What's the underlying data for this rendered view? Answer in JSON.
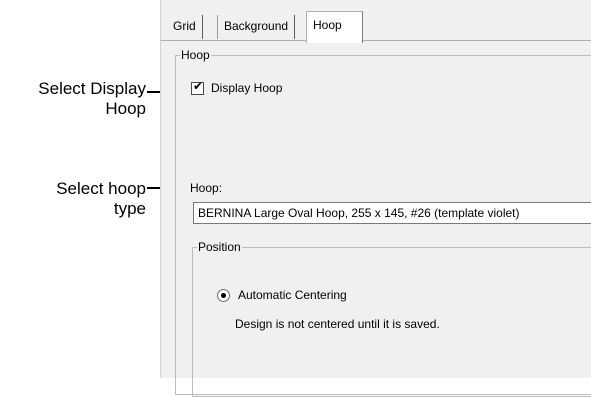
{
  "tabs": [
    {
      "label": "Grid"
    },
    {
      "label": "Background"
    },
    {
      "label": "Hoop"
    }
  ],
  "active_tab": "Hoop",
  "hoop_group": {
    "legend": "Hoop",
    "display_hoop": {
      "label": "Display Hoop",
      "checked": true
    },
    "hoop_field": {
      "label": "Hoop:",
      "value": "BERNINA Large Oval Hoop, 255 x 145, #26 (template violet)"
    }
  },
  "position_group": {
    "legend": "Position",
    "automatic_centering": {
      "label": "Automatic Centering",
      "selected": true
    },
    "note": "Design is not centered until it is saved."
  },
  "callouts": {
    "display_hoop": {
      "line1": "Select Display",
      "line2": "Hoop"
    },
    "hoop_type": {
      "line1": "Select hoop",
      "line2": "type"
    }
  }
}
